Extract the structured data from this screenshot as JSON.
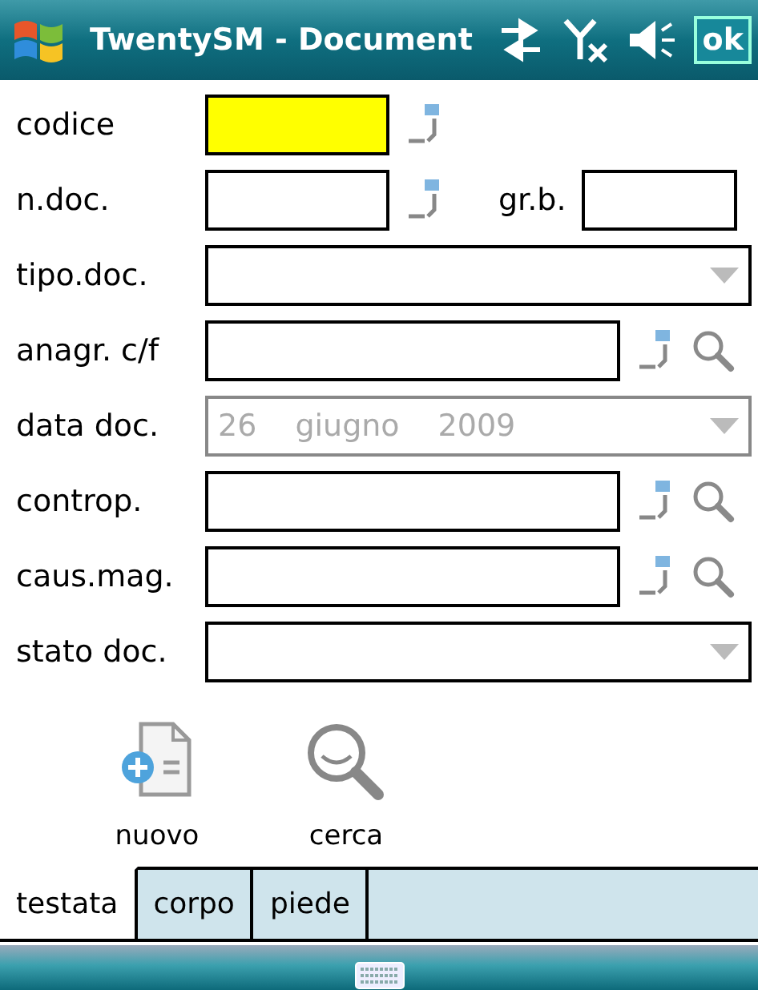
{
  "window": {
    "title": "TwentySM - Document",
    "ok": "ok"
  },
  "rows": [
    {
      "label": "codice",
      "kind": "short",
      "focused": true
    },
    {
      "label": "n.doc.",
      "kind": "short",
      "focused": false,
      "extra_label": "gr.b."
    },
    {
      "label": "tipo.doc.",
      "kind": "dropdown"
    },
    {
      "label": "anagr. c/f",
      "kind": "lookup",
      "focused": false
    },
    {
      "label": "data doc.",
      "kind": "date",
      "disabled": true,
      "day": "26",
      "month": "giugno",
      "year": "2009"
    },
    {
      "label": "controp.",
      "kind": "lookup",
      "focused": false
    },
    {
      "label": "caus.mag.",
      "kind": "lookup",
      "focused": false
    },
    {
      "label": "stato doc.",
      "kind": "dropdown"
    }
  ],
  "actions": [
    {
      "label": "nuovo",
      "kind": "new"
    },
    {
      "label": "cerca",
      "kind": "search"
    }
  ],
  "tabs": [
    {
      "label": "testata",
      "selected": true
    },
    {
      "label": "corpo",
      "selected": false
    },
    {
      "label": "piede",
      "selected": false
    }
  ]
}
